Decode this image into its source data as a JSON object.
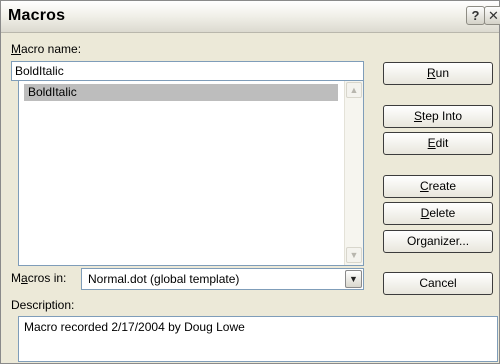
{
  "window": {
    "title": "Macros",
    "help_glyph": "?",
    "close_glyph": "✕"
  },
  "macro_name": {
    "label_hotkey": "M",
    "label_rest": "acro name:",
    "value": "BoldItalic"
  },
  "macro_list": {
    "items": [
      "BoldItalic"
    ],
    "scroll_up_glyph": "▲",
    "scroll_down_glyph": "▼"
  },
  "buttons": {
    "run": {
      "hotkey": "R",
      "rest": "un"
    },
    "step_into": {
      "hotkey": "S",
      "rest": "tep Into"
    },
    "edit": {
      "hotkey": "E",
      "rest": "dit"
    },
    "create": {
      "hotkey": "C",
      "rest": "reate"
    },
    "delete": {
      "hotkey": "D",
      "rest": "elete"
    },
    "organizer": {
      "pre": "Or",
      "hotkey": "g",
      "rest": "anizer..."
    },
    "cancel": {
      "label": "Cancel"
    }
  },
  "macros_in": {
    "label_pre": "M",
    "label_hotkey": "a",
    "label_rest": "cros in:",
    "value": "Normal.dot (global template)",
    "arrow_glyph": "▼"
  },
  "description": {
    "label": "Description:",
    "value": "Macro recorded 2/17/2004 by Doug Lowe"
  }
}
